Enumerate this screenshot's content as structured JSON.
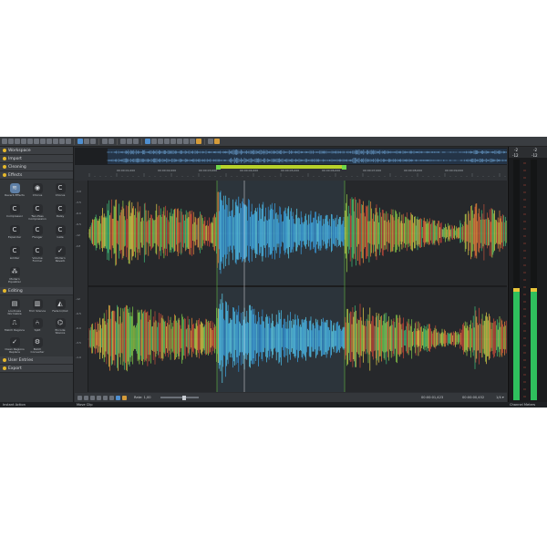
{
  "sidebar": {
    "sections": [
      {
        "label": "Workspace"
      },
      {
        "label": "Import"
      },
      {
        "label": "Cleaning"
      },
      {
        "label": "Effects"
      }
    ],
    "effects": [
      {
        "label": "Reverb Effects",
        "icon": "reverb-icon",
        "glyph": "≋"
      },
      {
        "label": "Chorus",
        "icon": "chorus-icon",
        "glyph": "◉"
      },
      {
        "label": "Chorus",
        "icon": "chorus-icon",
        "glyph": "C"
      },
      {
        "label": "Compressor",
        "icon": "compressor-icon",
        "glyph": "C"
      },
      {
        "label": "Two-Pass Compression",
        "icon": "compression-icon",
        "glyph": "C"
      },
      {
        "label": "Delay",
        "icon": "delay-icon",
        "glyph": "C"
      },
      {
        "label": "Expander",
        "icon": "expander-icon",
        "glyph": "C"
      },
      {
        "label": "Flanger",
        "icon": "flanger-icon",
        "glyph": "C"
      },
      {
        "label": "Gate",
        "icon": "gate-icon",
        "glyph": "C"
      },
      {
        "label": "Limiter",
        "icon": "limiter-icon",
        "glyph": "C"
      },
      {
        "label": "Volume Former",
        "icon": "volume-icon",
        "glyph": "C"
      },
      {
        "label": "Modern Reverb",
        "icon": "modern-reverb-icon",
        "glyph": "✓"
      },
      {
        "label": "Modern Equalizer",
        "icon": "equalizer-icon",
        "glyph": "⁂"
      }
    ],
    "editing_label": "Editing",
    "editing": [
      {
        "label": "Loudness Normalize",
        "icon": "loudness-icon",
        "glyph": "▤"
      },
      {
        "label": "Trim Silence",
        "icon": "trim-icon",
        "glyph": "▥"
      },
      {
        "label": "Fade In/Out",
        "icon": "fade-icon",
        "glyph": "◭"
      },
      {
        "label": "Match Regions",
        "icon": "match-icon",
        "glyph": "⎍"
      },
      {
        "label": "Split",
        "icon": "split-icon",
        "glyph": "⑃"
      },
      {
        "label": "Encode Silence",
        "icon": "encode-icon",
        "glyph": "⌬"
      },
      {
        "label": "Clean Regions Replace",
        "icon": "clean-icon",
        "glyph": "✓"
      },
      {
        "label": "Batch Converter",
        "icon": "batch-icon",
        "glyph": "⚙"
      }
    ],
    "user_entries_label": "User Entries",
    "export_label": "Export"
  },
  "ruler_marks": [
    "00:00:01,000",
    "00:00:02,000",
    "00:00:03,000",
    "00:00:04,000",
    "00:00:05,000",
    "00:00:06,000",
    "00:00:07,000",
    "00:00:08,000",
    "00:00:09,000"
  ],
  "scale_labels": [
    "-1.0",
    "-3.5",
    "-6.0",
    "-9.5",
    "-12",
    "-Inf",
    "-12",
    "-9.5",
    "-6.0",
    "-3.5",
    "-1.0"
  ],
  "transport": {
    "rate_label": "Rate: 1,00",
    "position": "00:00:01,423",
    "length": "00:00:00,452",
    "zoom": "1/4 ▾"
  },
  "meters": {
    "left_peak": "-2",
    "right_peak": "-2",
    "left_db": "-12",
    "right_db": "-12",
    "left_level": 0.45,
    "right_level": 0.45
  },
  "status": {
    "left": "Instant Action",
    "middle": "Move Clip",
    "right": "Channel Meters"
  },
  "colors": {
    "accent": "#e5b82c",
    "selection": "#b8d22a",
    "meter": "#2fbf5d"
  }
}
